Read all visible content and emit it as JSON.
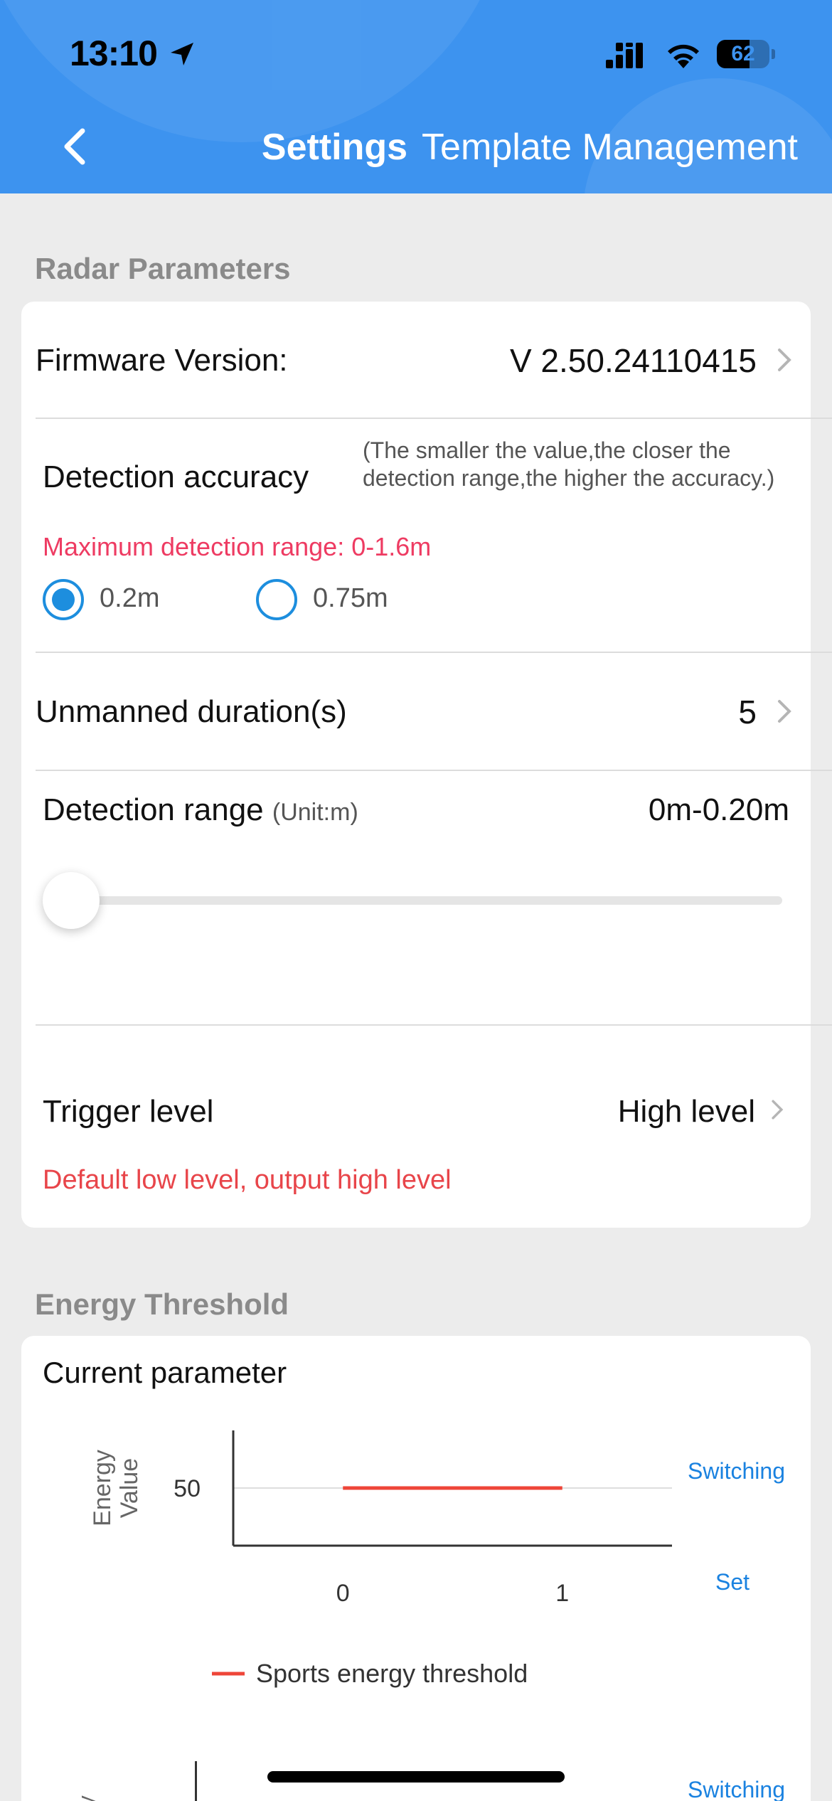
{
  "status_bar": {
    "time": "13:10",
    "battery": "62",
    "battery_level": 0.62
  },
  "header": {
    "title": "Settings",
    "subtitle": "Template Management"
  },
  "radar": {
    "section_title": "Radar Parameters",
    "firmware_label": "Firmware Version:",
    "firmware_value": "V 2.50.24110415",
    "accuracy_label": "Detection accuracy",
    "accuracy_note": "(The smaller the value,the closer the detection range,the higher the accuracy.)",
    "max_range_text": "Maximum detection range: 0-1.6m",
    "options": [
      {
        "label": "0.2m",
        "selected": true
      },
      {
        "label": "0.75m",
        "selected": false
      }
    ],
    "unmanned_label": "Unmanned duration(s)",
    "unmanned_value": "5",
    "range_label": "Detection range",
    "range_unit": "(Unit:m)",
    "range_value": "0m-0.20m",
    "slider_level": 0,
    "trigger_label": "Trigger level",
    "trigger_value": "High level",
    "trigger_note": "Default low level, output high level"
  },
  "energy": {
    "section_title": "Energy Threshold",
    "current_label": "Current parameter",
    "switching_label": "Switching",
    "set_label": "Set",
    "switching_label_2": "Switching"
  },
  "chart_data": {
    "type": "line",
    "x": [
      0,
      1
    ],
    "series": [
      {
        "name": "Sports energy threshold",
        "values": [
          50,
          50
        ],
        "color": "#ee4538"
      }
    ],
    "ylabel": "Energy Value",
    "xlabel": "",
    "yticks": [
      50
    ],
    "xticks": [
      0,
      1
    ],
    "legend": "bottom",
    "grid": true
  },
  "colors": {
    "header_blue": "#3d93ef",
    "accent_blue": "#1d8ede",
    "red": "#e8454a"
  }
}
